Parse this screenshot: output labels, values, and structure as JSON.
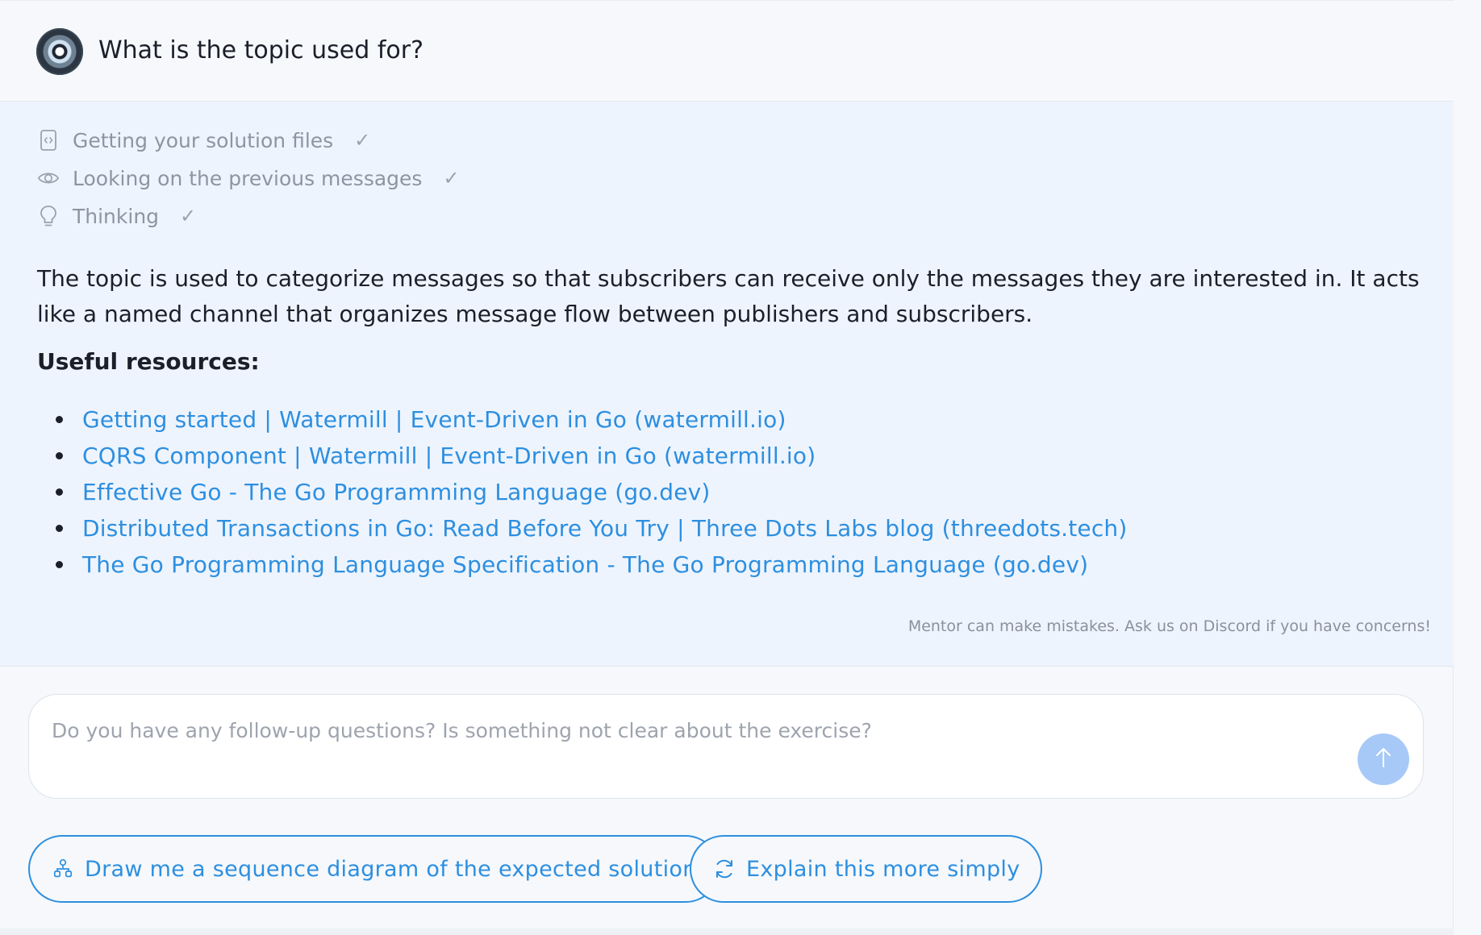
{
  "question": {
    "text": "What is the topic used for?"
  },
  "steps": [
    {
      "label": "Getting your solution files",
      "icon": "code-file-icon",
      "status": "✓"
    },
    {
      "label": "Looking on the previous messages",
      "icon": "eye-icon",
      "status": "✓"
    },
    {
      "label": "Thinking",
      "icon": "lightbulb-icon",
      "status": "✓"
    }
  ],
  "answer": {
    "text": "The topic is used to categorize messages so that subscribers can receive only the messages they are interested in. It acts like a named channel that organizes message flow between publishers and subscribers.",
    "resources_heading": "Useful resources:",
    "resources": [
      "Getting started | Watermill | Event-Driven in Go (watermill.io)",
      "CQRS Component | Watermill | Event-Driven in Go (watermill.io)",
      "Effective Go - The Go Programming Language (go.dev)",
      "Distributed Transactions in Go: Read Before You Try | Three Dots Labs blog (threedots.tech)",
      "The Go Programming Language Specification - The Go Programming Language (go.dev)"
    ],
    "disclaimer": "Mentor can make mistakes. Ask us on Discord if you have concerns!"
  },
  "input": {
    "placeholder": "Do you have any follow-up questions? Is something not clear about the exercise?",
    "value": ""
  },
  "suggestions": [
    {
      "label": "Draw me a sequence diagram of the expected solution",
      "icon": "sitemap-icon"
    },
    {
      "label": "Explain this more simply",
      "icon": "refresh-icon"
    }
  ],
  "colors": {
    "accent": "#2d8fe0",
    "answer_bg": "#eef4fd",
    "send_button": "#a6c9f8",
    "muted_text": "#8d95a3"
  }
}
